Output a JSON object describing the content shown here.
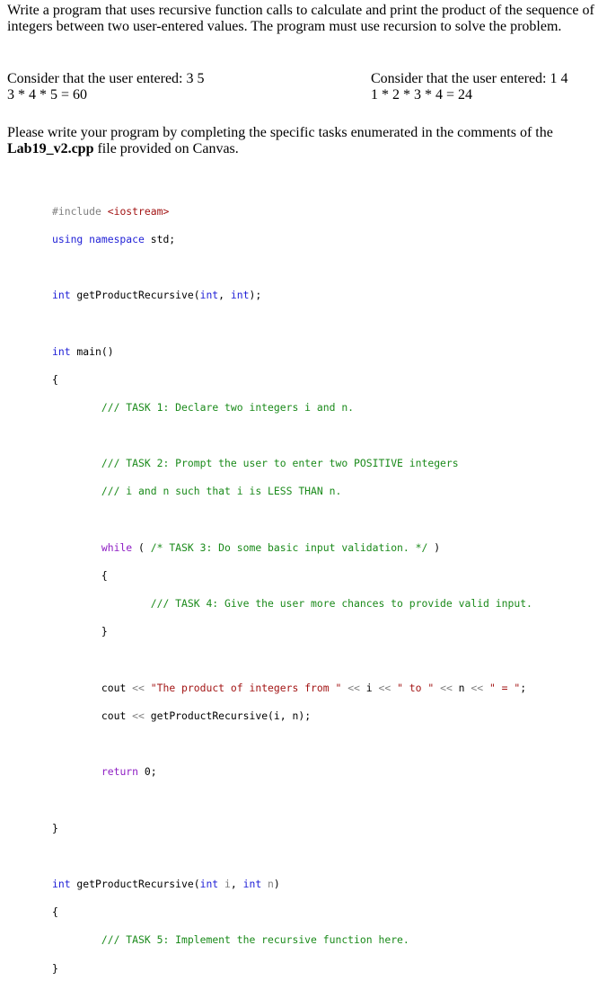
{
  "intro": {
    "paragraph": "Write a program that uses recursive function calls to calculate and print the product of the sequence of integers between two user-entered values.  The program must use recursion to solve the problem."
  },
  "examples": [
    {
      "label": "Consider that the user entered: 3 5",
      "result": "3 * 4  * 5 = 60"
    },
    {
      "label": "Consider that the user entered: 1 4",
      "result": "1 * 2 * 3 * 4 = 24"
    }
  ],
  "instructions": {
    "text_before": "Please write your program by completing the specific tasks enumerated in the comments of the ",
    "filename": "Lab19_v2.cpp",
    "text_after": " file provided on Canvas."
  },
  "code": {
    "include_directive": "#include",
    "include_header": " <iostream>",
    "using_kw": "using namespace",
    "using_rest": " std;",
    "int_kw": "int",
    "proto_name": " getProductRecursive(",
    "proto_comma": ", ",
    "proto_end": ");",
    "main_name": " main()",
    "open_brace": "{",
    "close_brace": "}",
    "task1": "/// TASK 1: Declare two integers i and n.",
    "task2a": "/// TASK 2: Prompt the user to enter two POSITIVE integers",
    "task2b": "/// i and n such that i is LESS THAN n.",
    "while_kw": "while",
    "while_open": " ( ",
    "task3": "/* TASK 3: Do some basic input validation. */",
    "while_close": " )",
    "task4": "/// TASK 4: Give the user more chances to provide valid input.",
    "cout": "cout",
    "shift": " << ",
    "str1": "\"The product of integers from \"",
    "var_i": "i",
    "str2": "\" to \"",
    "var_n": "n",
    "str3": "\" = \"",
    "semicolon": ";",
    "call": "getProductRecursive(i, n);",
    "return_kw": "return",
    "return_val": " 0;",
    "def_name": " getProductRecursive(",
    "param_i": " i",
    "param_sep": ", ",
    "param_n": " n",
    "def_close": ")",
    "task5": "/// TASK 5: Implement the recursive function here."
  }
}
